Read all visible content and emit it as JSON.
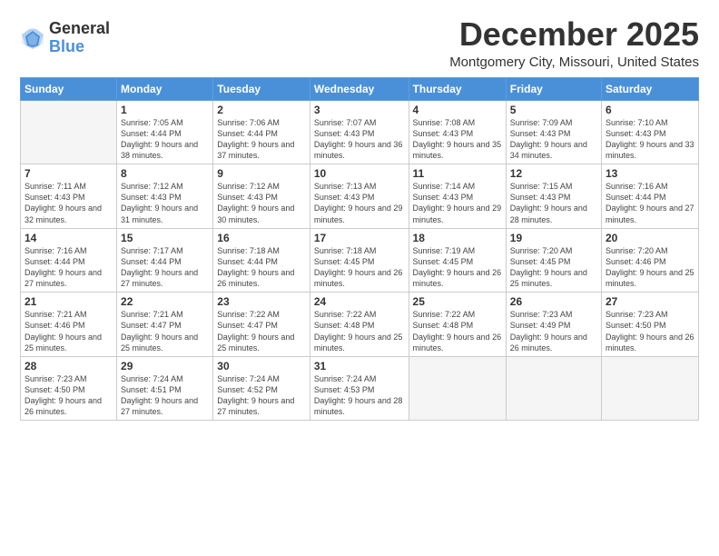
{
  "header": {
    "logo": {
      "line1": "General",
      "line2": "Blue"
    },
    "title": "December 2025",
    "location": "Montgomery City, Missouri, United States"
  },
  "calendar": {
    "days_of_week": [
      "Sunday",
      "Monday",
      "Tuesday",
      "Wednesday",
      "Thursday",
      "Friday",
      "Saturday"
    ],
    "weeks": [
      [
        {
          "day": "",
          "empty": true
        },
        {
          "day": "1",
          "sunrise": "7:05 AM",
          "sunset": "4:44 PM",
          "daylight": "9 hours and 38 minutes."
        },
        {
          "day": "2",
          "sunrise": "7:06 AM",
          "sunset": "4:44 PM",
          "daylight": "9 hours and 37 minutes."
        },
        {
          "day": "3",
          "sunrise": "7:07 AM",
          "sunset": "4:43 PM",
          "daylight": "9 hours and 36 minutes."
        },
        {
          "day": "4",
          "sunrise": "7:08 AM",
          "sunset": "4:43 PM",
          "daylight": "9 hours and 35 minutes."
        },
        {
          "day": "5",
          "sunrise": "7:09 AM",
          "sunset": "4:43 PM",
          "daylight": "9 hours and 34 minutes."
        },
        {
          "day": "6",
          "sunrise": "7:10 AM",
          "sunset": "4:43 PM",
          "daylight": "9 hours and 33 minutes."
        }
      ],
      [
        {
          "day": "7",
          "sunrise": "7:11 AM",
          "sunset": "4:43 PM",
          "daylight": "9 hours and 32 minutes."
        },
        {
          "day": "8",
          "sunrise": "7:12 AM",
          "sunset": "4:43 PM",
          "daylight": "9 hours and 31 minutes."
        },
        {
          "day": "9",
          "sunrise": "7:12 AM",
          "sunset": "4:43 PM",
          "daylight": "9 hours and 30 minutes."
        },
        {
          "day": "10",
          "sunrise": "7:13 AM",
          "sunset": "4:43 PM",
          "daylight": "9 hours and 29 minutes."
        },
        {
          "day": "11",
          "sunrise": "7:14 AM",
          "sunset": "4:43 PM",
          "daylight": "9 hours and 29 minutes."
        },
        {
          "day": "12",
          "sunrise": "7:15 AM",
          "sunset": "4:43 PM",
          "daylight": "9 hours and 28 minutes."
        },
        {
          "day": "13",
          "sunrise": "7:16 AM",
          "sunset": "4:44 PM",
          "daylight": "9 hours and 27 minutes."
        }
      ],
      [
        {
          "day": "14",
          "sunrise": "7:16 AM",
          "sunset": "4:44 PM",
          "daylight": "9 hours and 27 minutes."
        },
        {
          "day": "15",
          "sunrise": "7:17 AM",
          "sunset": "4:44 PM",
          "daylight": "9 hours and 27 minutes."
        },
        {
          "day": "16",
          "sunrise": "7:18 AM",
          "sunset": "4:44 PM",
          "daylight": "9 hours and 26 minutes."
        },
        {
          "day": "17",
          "sunrise": "7:18 AM",
          "sunset": "4:45 PM",
          "daylight": "9 hours and 26 minutes."
        },
        {
          "day": "18",
          "sunrise": "7:19 AM",
          "sunset": "4:45 PM",
          "daylight": "9 hours and 26 minutes."
        },
        {
          "day": "19",
          "sunrise": "7:20 AM",
          "sunset": "4:45 PM",
          "daylight": "9 hours and 25 minutes."
        },
        {
          "day": "20",
          "sunrise": "7:20 AM",
          "sunset": "4:46 PM",
          "daylight": "9 hours and 25 minutes."
        }
      ],
      [
        {
          "day": "21",
          "sunrise": "7:21 AM",
          "sunset": "4:46 PM",
          "daylight": "9 hours and 25 minutes."
        },
        {
          "day": "22",
          "sunrise": "7:21 AM",
          "sunset": "4:47 PM",
          "daylight": "9 hours and 25 minutes."
        },
        {
          "day": "23",
          "sunrise": "7:22 AM",
          "sunset": "4:47 PM",
          "daylight": "9 hours and 25 minutes."
        },
        {
          "day": "24",
          "sunrise": "7:22 AM",
          "sunset": "4:48 PM",
          "daylight": "9 hours and 25 minutes."
        },
        {
          "day": "25",
          "sunrise": "7:22 AM",
          "sunset": "4:48 PM",
          "daylight": "9 hours and 26 minutes."
        },
        {
          "day": "26",
          "sunrise": "7:23 AM",
          "sunset": "4:49 PM",
          "daylight": "9 hours and 26 minutes."
        },
        {
          "day": "27",
          "sunrise": "7:23 AM",
          "sunset": "4:50 PM",
          "daylight": "9 hours and 26 minutes."
        }
      ],
      [
        {
          "day": "28",
          "sunrise": "7:23 AM",
          "sunset": "4:50 PM",
          "daylight": "9 hours and 26 minutes."
        },
        {
          "day": "29",
          "sunrise": "7:24 AM",
          "sunset": "4:51 PM",
          "daylight": "9 hours and 27 minutes."
        },
        {
          "day": "30",
          "sunrise": "7:24 AM",
          "sunset": "4:52 PM",
          "daylight": "9 hours and 27 minutes."
        },
        {
          "day": "31",
          "sunrise": "7:24 AM",
          "sunset": "4:53 PM",
          "daylight": "9 hours and 28 minutes."
        },
        {
          "day": "",
          "empty": true
        },
        {
          "day": "",
          "empty": true
        },
        {
          "day": "",
          "empty": true
        }
      ]
    ]
  }
}
